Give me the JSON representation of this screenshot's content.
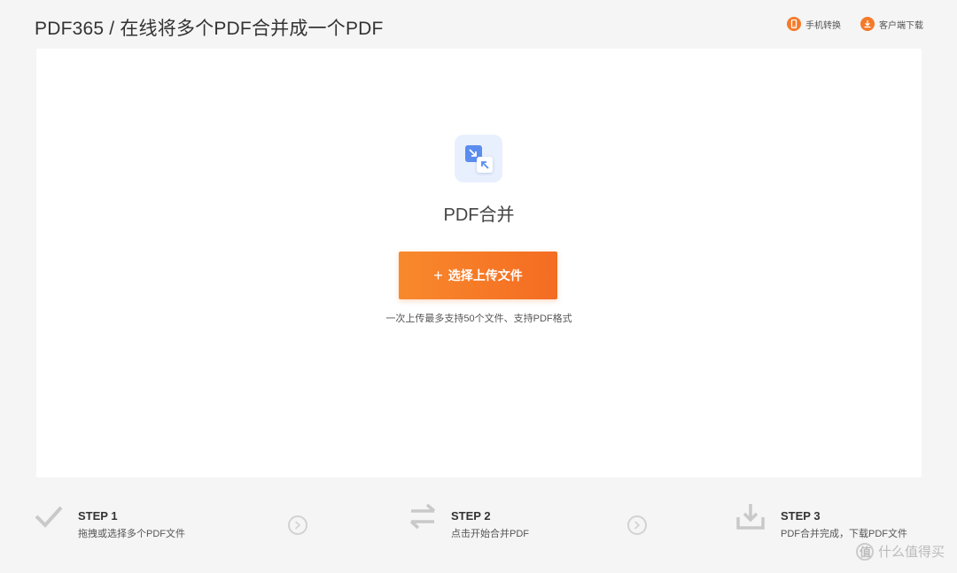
{
  "header": {
    "title": "PDF365 / 在线将多个PDF合并成一个PDF",
    "links": [
      {
        "label": "手机转换",
        "icon": "phone-icon"
      },
      {
        "label": "客户端下载",
        "icon": "download-icon"
      }
    ]
  },
  "main": {
    "tool_icon": "merge-arrows-icon",
    "tool_title": "PDF合并",
    "upload_button": {
      "icon": "plus-icon",
      "label": "选择上传文件"
    },
    "hint": "一次上传最多支持50个文件、支持PDF格式"
  },
  "steps": [
    {
      "label": "STEP 1",
      "desc": "拖拽或选择多个PDF文件",
      "icon": "checkmark-icon"
    },
    {
      "label": "STEP 2",
      "desc": "点击开始合并PDF",
      "icon": "swap-arrows-icon"
    },
    {
      "label": "STEP 3",
      "desc": "PDF合并完成，下载PDF文件",
      "icon": "download-tray-icon"
    }
  ],
  "watermark": {
    "text": "什么值得买",
    "icon": "zhi-logo-icon",
    "icon_glyph": "值"
  },
  "colors": {
    "accent": "#f46c22",
    "background": "#f5f5f5",
    "icon_blue": "#5b8def"
  }
}
